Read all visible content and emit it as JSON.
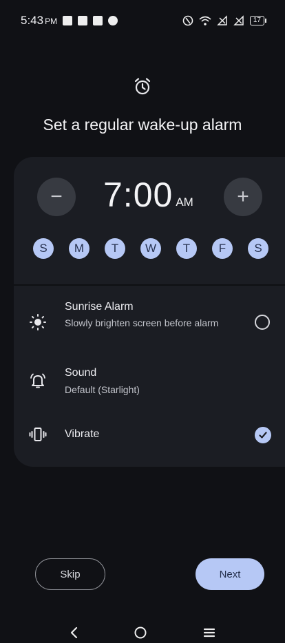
{
  "status_bar": {
    "time": "5:43",
    "ampm": "PM",
    "battery_level": "17"
  },
  "header": {
    "icon": "alarm-clock-icon",
    "title": "Set a regular wake-up alarm"
  },
  "time_picker": {
    "time": "7:00",
    "ampm": "AM",
    "decrement_label": "−",
    "increment_label": "+"
  },
  "days": [
    {
      "label": "S",
      "selected": true
    },
    {
      "label": "M",
      "selected": true
    },
    {
      "label": "T",
      "selected": true
    },
    {
      "label": "W",
      "selected": true
    },
    {
      "label": "T",
      "selected": true
    },
    {
      "label": "F",
      "selected": true
    },
    {
      "label": "S",
      "selected": true
    }
  ],
  "options": {
    "sunrise": {
      "title": "Sunrise Alarm",
      "subtitle": "Slowly brighten screen before alarm",
      "checked": false,
      "icon": "sunrise-icon"
    },
    "sound": {
      "title": "Sound",
      "subtitle": "Default (Starlight)",
      "icon": "bell-icon"
    },
    "vibrate": {
      "title": "Vibrate",
      "checked": true,
      "icon": "vibrate-icon"
    }
  },
  "buttons": {
    "skip": "Skip",
    "next": "Next"
  },
  "colors": {
    "background": "#101115",
    "card": "#1b1d23",
    "accent": "#b6c8f5"
  }
}
